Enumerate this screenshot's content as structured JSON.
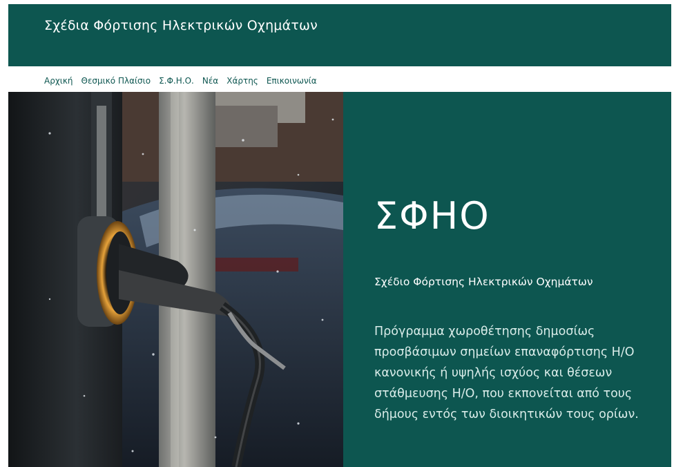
{
  "header": {
    "site_title": "Σχέδια Φόρτισης Ηλεκτρικών Οχημάτων"
  },
  "nav": {
    "items": [
      {
        "label": "Αρχική"
      },
      {
        "label": "Θεσμικό Πλαίσιο"
      },
      {
        "label": "Σ.Φ.Η.Ο."
      },
      {
        "label": "Νέα"
      },
      {
        "label": "Χάρτης"
      },
      {
        "label": "Επικοινωνία"
      }
    ]
  },
  "hero": {
    "heading": "ΣΦΗΟ",
    "subtitle": "Σχέδιο Φόρτισης Ηλεκτρικών Οχημάτων",
    "description": "Πρόγραμμα χωροθέτησης δημοσίως προσβάσιμων σημείων επαναφόρτισης Η/Ο κανονικής ή υψηλής ισχύος και θέσεων στάθμευσης Η/Ο, που εκπονείται από τους δήμους εντός των διοικητικών τους ορίων."
  },
  "colors": {
    "brand": "#0d5650",
    "text_on_brand": "#ffffff",
    "nav_text": "#0d5650"
  }
}
